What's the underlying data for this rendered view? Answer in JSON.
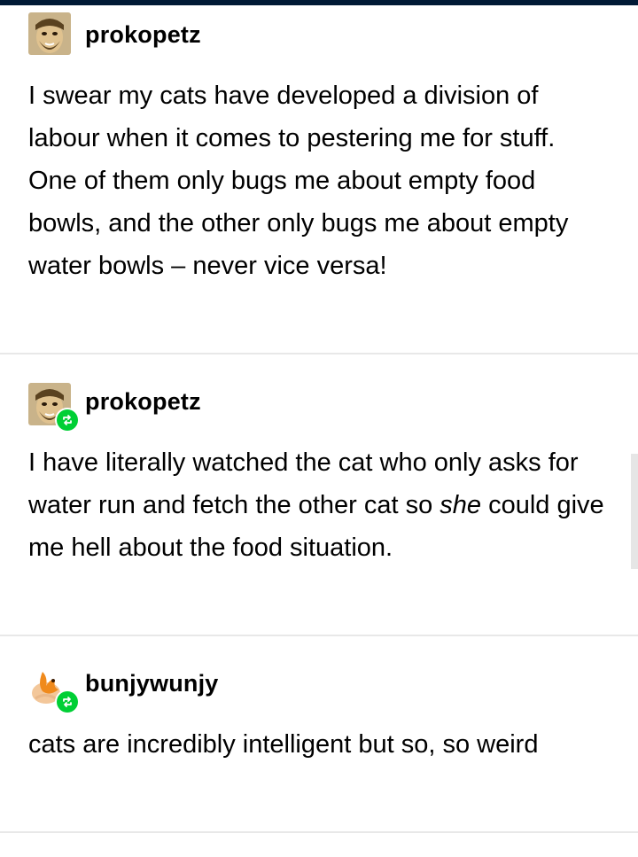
{
  "colors": {
    "top_bar": "#001935",
    "reblog_badge": "#00cf35",
    "divider": "#e8e8e8"
  },
  "posts": [
    {
      "username": "prokopetz",
      "avatar_icon": "bearded-man-avatar",
      "reblog": false,
      "text": "I swear my cats have developed a division of labour when it comes to pestering me for stuff. One of them only bugs me about empty food bowls, and the other only bugs me about empty water bowls – never vice versa!"
    },
    {
      "username": "prokopetz",
      "avatar_icon": "bearded-man-avatar",
      "reblog": true,
      "text_before": "I have literally watched the cat who only asks for water run and fetch the other cat so ",
      "text_emphasis": "she",
      "text_after": " could give me hell about the food situation."
    },
    {
      "username": "bunjywunjy",
      "avatar_icon": "orange-bird-avatar",
      "reblog": true,
      "text": "cats are incredibly intelligent but so, so weird"
    }
  ]
}
